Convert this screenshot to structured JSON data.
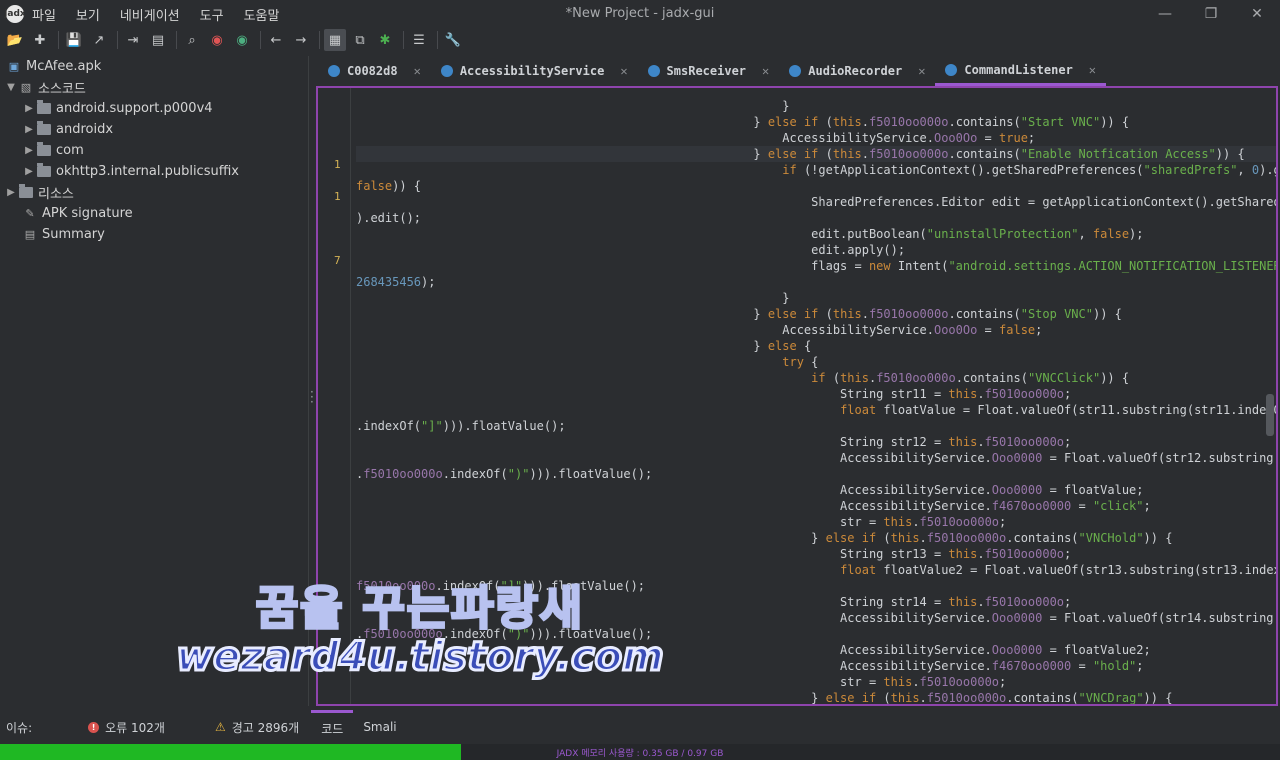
{
  "window": {
    "title": "*New Project - jadx-gui",
    "logo": "jadx",
    "minimize": "—",
    "maximize": "❐",
    "close": "✕"
  },
  "menu": [
    "파일",
    "보기",
    "네비게이션",
    "도구",
    "도움말"
  ],
  "sidebar": {
    "root": "McAfee.apk",
    "source": "소스코드",
    "packages": [
      "android.support.p000v4",
      "androidx",
      "com",
      "okhttp3.internal.publicsuffix"
    ],
    "resources": "리소스",
    "apk_signature": "APK signature",
    "summary": "Summary"
  },
  "tabs": [
    {
      "label": "C0082d8",
      "active": false
    },
    {
      "label": "AccessibilityService",
      "active": false
    },
    {
      "label": "SmsReceiver",
      "active": false
    },
    {
      "label": "AudioRecorder",
      "active": false
    },
    {
      "label": "CommandListener",
      "active": true
    }
  ],
  "gutter": [
    "1",
    "1",
    "7"
  ],
  "bottom": {
    "issues_label": "이슈:",
    "errors": "오류 102개",
    "warnings": "경고 2896개",
    "code_tab": "코드",
    "smali_tab": "Smali"
  },
  "status": {
    "memory": "JADX 메모리 사용량 : 0.35 GB / 0.97 GB",
    "memory_fraction": 0.36
  },
  "watermark": {
    "line1": "꿈을 꾸는파랑새",
    "line2": "wezard4u.tistory.com"
  },
  "colors": {
    "accent": "#9b59d0",
    "keyword": "#cc8a3a",
    "string": "#6ab04c",
    "memory_bar": "#1fb823"
  }
}
